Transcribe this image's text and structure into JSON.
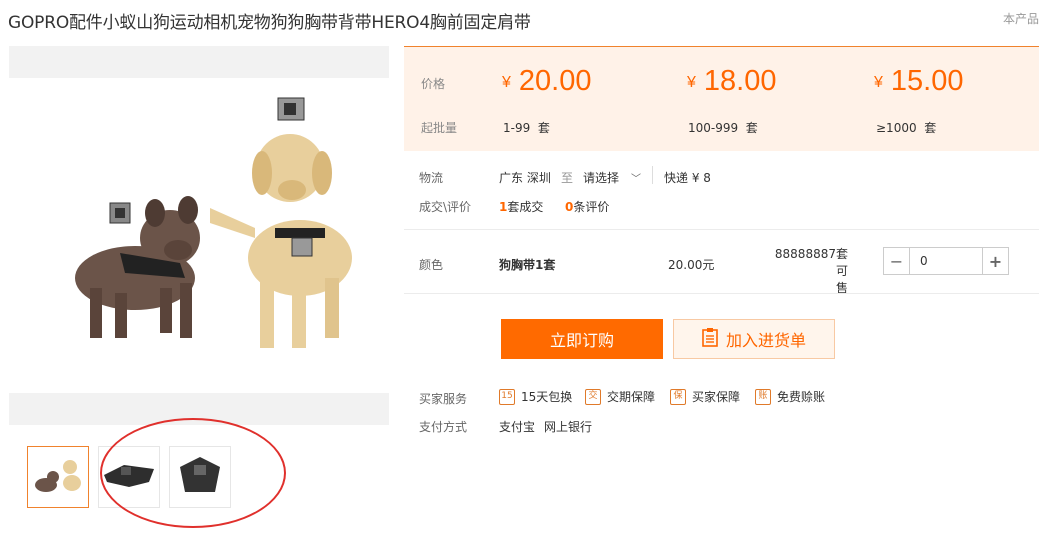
{
  "product": {
    "title": "GOPRO配件小蚁山狗运动相机宠物狗狗胸带背带HERO4胸前固定肩带",
    "corner_note": "本产品"
  },
  "price": {
    "label": "价格",
    "min_label": "起批量",
    "tiers": [
      {
        "currency": "¥",
        "price": "20.00",
        "range": "1-99",
        "unit": "套"
      },
      {
        "currency": "¥",
        "price": "18.00",
        "range": "100-999",
        "unit": "套"
      },
      {
        "currency": "¥",
        "price": "15.00",
        "range": "≥1000",
        "unit": "套"
      }
    ]
  },
  "logistics": {
    "label": "物流",
    "from": "广东 深圳",
    "to_word": "至",
    "select_placeholder": "请选择",
    "express": "快递 ¥ 8"
  },
  "deals": {
    "label": "成交\\评价",
    "count": "1",
    "count_suffix": "套成交",
    "reviews": "0",
    "reviews_suffix": "条评价"
  },
  "variant": {
    "label": "颜色",
    "name": "狗胸带1套",
    "price": "20.00元",
    "stock_line1": "88888887套可",
    "stock_line2": "售",
    "quantity": "0"
  },
  "actions": {
    "buy": "立即订购",
    "cart": "加入进货单"
  },
  "services": {
    "label": "买家服务",
    "items": [
      {
        "icon": "15",
        "text": "15天包换"
      },
      {
        "icon": "交",
        "text": "交期保障"
      },
      {
        "icon": "保",
        "text": "买家保障"
      },
      {
        "icon": "账",
        "text": "免费赊账"
      }
    ]
  },
  "payment": {
    "label": "支付方式",
    "methods": [
      "支付宝",
      "网上银行"
    ]
  },
  "colors": {
    "accent": "#ff6600",
    "price_bg": "#fff2e8",
    "highlight_circle": "#e0302c"
  }
}
